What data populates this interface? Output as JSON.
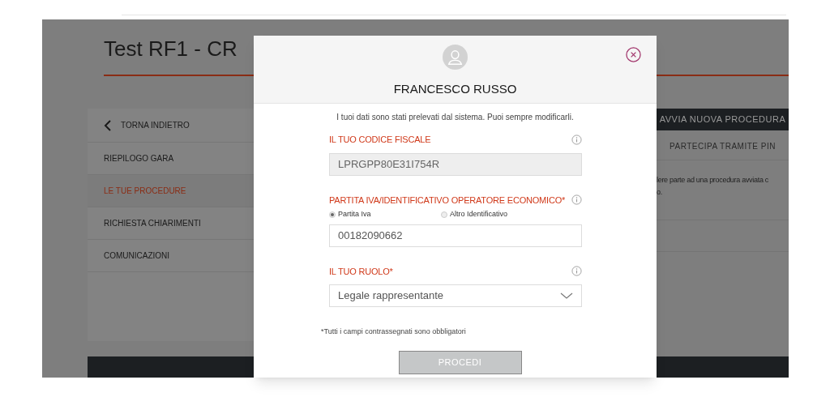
{
  "page": {
    "title": "Test RF1 - CR"
  },
  "sidebar": {
    "back": "TORNA INDIETRO",
    "items": [
      {
        "label": "RIEPILOGO GARA",
        "selected": false
      },
      {
        "label": "LE TUE PROCEDURE",
        "selected": true
      },
      {
        "label": "RICHIESTA CHIARIMENTI",
        "selected": false
      },
      {
        "label": "COMUNICAZIONI",
        "selected": false
      }
    ]
  },
  "actions": [
    {
      "label": "AVVIA NUOVA PROCEDURA",
      "kind": "primary"
    },
    {
      "label": "PARTECIPA TRAMITE PIN",
      "kind": "secondary"
    }
  ],
  "content_text": [
    "lere parte ad una procedura avviata c",
    "o."
  ],
  "modal": {
    "name": "FRANCESCO RUSSO",
    "intro": "I tuoi dati sono stati prelevati dal sistema. Puoi sempre modificarli.",
    "fields": [
      {
        "kind": "text",
        "label": "IL TUO CODICE FISCALE",
        "value": "LPRGPP80E31I754R",
        "disabled": true
      },
      {
        "kind": "text",
        "label": "PARTITA IVA/IDENTIFICATIVO OPERATORE ECONOMICO*",
        "value": "00182090662",
        "options": [
          {
            "label": "Partita Iva",
            "selected": true
          },
          {
            "label": "Altro Identificativo",
            "selected": false
          }
        ]
      },
      {
        "kind": "select",
        "label": "IL TUO RUOLO*",
        "value": "Legale rappresentante"
      }
    ],
    "note": "*Tutti i campi contrassegnati sono obbligatori",
    "submit": {
      "label": "PROCEDI",
      "disabled": true
    }
  }
}
